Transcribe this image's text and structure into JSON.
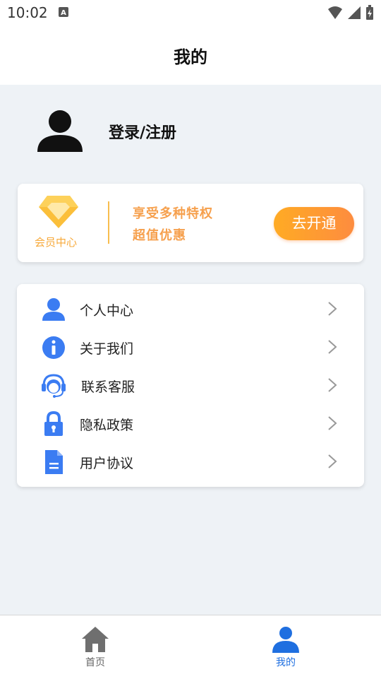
{
  "status_bar": {
    "time": "10:02"
  },
  "header": {
    "title": "我的"
  },
  "profile": {
    "login_label": "登录/注册"
  },
  "vip": {
    "label": "会员中心",
    "line1": "享受多种特权",
    "line2": "超值优惠",
    "button_label": "去开通",
    "accent_color": "#f6a04d"
  },
  "menu": {
    "items": [
      {
        "label": "个人中心",
        "icon": "person-icon"
      },
      {
        "label": "关于我们",
        "icon": "info-icon"
      },
      {
        "label": "联系客服",
        "icon": "customer-service-icon"
      },
      {
        "label": "隐私政策",
        "icon": "lock-icon"
      },
      {
        "label": "用户协议",
        "icon": "document-icon"
      }
    ],
    "icon_color": "#3b7cf2"
  },
  "tabbar": {
    "tabs": [
      {
        "label": "首页",
        "icon": "home-icon",
        "active": false
      },
      {
        "label": "我的",
        "icon": "person-icon",
        "active": true
      }
    ],
    "active_color": "#1f6fe0",
    "inactive_color": "#666666"
  }
}
